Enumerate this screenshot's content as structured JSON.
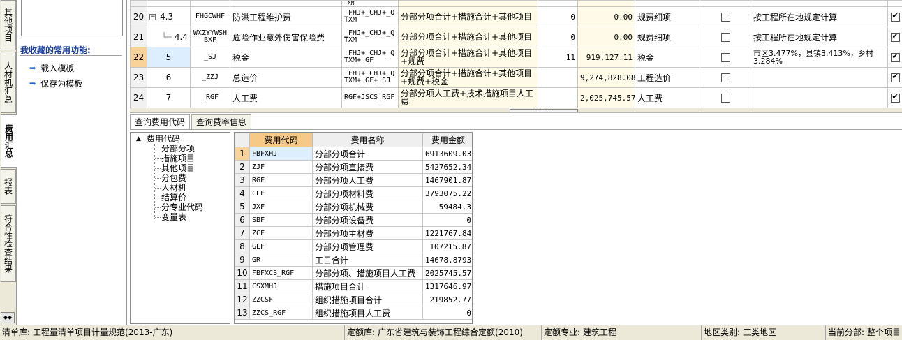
{
  "side_tabs": [
    {
      "label": "其他项目",
      "active": false
    },
    {
      "label": "人材机汇总",
      "active": false
    },
    {
      "label": "费用汇总",
      "active": true
    },
    {
      "label": "报表",
      "active": false
    },
    {
      "label": "符合性检查结果",
      "active": false
    }
  ],
  "favorites": {
    "title": "我收藏的常用功能:",
    "items": [
      "载入模板",
      "保存为模板"
    ]
  },
  "fee_rows": [
    {
      "rownum": "",
      "seq": "",
      "code": "",
      "name": "",
      "base": "TXM",
      "basedesc": "",
      "rate": "",
      "amount": "",
      "type": "",
      "note": "",
      "checked": false,
      "partial": true
    },
    {
      "rownum": "20",
      "seq": "4.3",
      "code": "FHGCWHF",
      "name": "防洪工程维护费",
      "base": "_FHJ+_CHJ+_QTXM",
      "basedesc": "分部分项合计+措施合计+其他项目",
      "rate": "0",
      "amount": "0.00",
      "type": "规费细项",
      "note": "按工程所在地规定计算",
      "checked": true,
      "tree": "minus"
    },
    {
      "rownum": "21",
      "seq": "4.4",
      "code": "WXZYYWSHBXF",
      "name": "危险作业意外伤害保险费",
      "base": "_FHJ+_CHJ+_QTXM",
      "basedesc": "分部分项合计+措施合计+其他项目",
      "rate": "0",
      "amount": "0.00",
      "type": "规费细项",
      "note": "按工程所在地规定计算",
      "checked": true,
      "tree": "leaf"
    },
    {
      "rownum": "22",
      "seq": "5",
      "code": "_SJ",
      "name": "税金",
      "base": "_FHJ+_CHJ+_QTXM+_GF",
      "basedesc": "分部分项合计+措施合计+其他项目+规费",
      "rate": "11",
      "amount": "919,127.11",
      "type": "税金",
      "note": "市区3.477%，县镇3.413%，乡村3.284%",
      "checked": true,
      "selected": true
    },
    {
      "rownum": "23",
      "seq": "6",
      "code": "_ZZJ",
      "name": "总造价",
      "base": "_FHJ+_CHJ+_QTXM+_GF+_SJ",
      "basedesc": "分部分项合计+措施合计+其他项目+规费+税金",
      "rate": "",
      "amount": "9,274,828.08",
      "type": "工程造价",
      "note": "",
      "checked": true
    },
    {
      "rownum": "24",
      "seq": "7",
      "code": "_RGF",
      "name": "人工费",
      "base": "RGF+JSCS_RGF",
      "basedesc": "分部分项人工费+技术措施项目人工费",
      "rate": "",
      "amount": "2,025,745.57",
      "type": "人工费",
      "note": "",
      "checked": true
    }
  ],
  "query_tabs": [
    {
      "label": "查询费用代码",
      "active": true
    },
    {
      "label": "查询费率信息",
      "active": false
    }
  ],
  "tree": {
    "root": "费用代码",
    "children": [
      "分部分项",
      "措施项目",
      "其他项目",
      "分包费",
      "人材机",
      "结算价",
      "分专业代码",
      "变量表"
    ]
  },
  "code_table": {
    "headers": [
      "",
      "费用代码",
      "费用名称",
      "费用金额"
    ],
    "rows": [
      [
        "1",
        "FBFXHJ",
        "分部分项合计",
        "6913609.03"
      ],
      [
        "2",
        "ZJF",
        "分部分项直接费",
        "5427652.34"
      ],
      [
        "3",
        "RGF",
        "分部分项人工费",
        "1467901.87"
      ],
      [
        "4",
        "CLF",
        "分部分项材料费",
        "3793075.22"
      ],
      [
        "5",
        "JXF",
        "分部分项机械费",
        "59484.3"
      ],
      [
        "6",
        "SBF",
        "分部分项设备费",
        "0"
      ],
      [
        "7",
        "ZCF",
        "分部分项主材费",
        "1221767.84"
      ],
      [
        "8",
        "GLF",
        "分部分项管理费",
        "107215.87"
      ],
      [
        "9",
        "GR",
        "工日合计",
        "14678.8793"
      ],
      [
        "10",
        "FBFXCS_RGF",
        "分部分项、措施项目人工费",
        "2025745.57"
      ],
      [
        "11",
        "CSXMHJ",
        "措施项目合计",
        "1317646.97"
      ],
      [
        "12",
        "ZZCSF",
        "组织措施项目合计",
        "219852.77"
      ],
      [
        "13",
        "ZZCS_RGF",
        "组织措施项目人工费",
        "0"
      ]
    ]
  },
  "status": {
    "qd_label": "清单库:",
    "qd_value": "工程量清单项目计量规范(2013-广东)",
    "de_label": "定额库:",
    "de_value": "广东省建筑与装饰工程综合定额(2010)",
    "zy_label": "定额专业:",
    "zy_value": "建筑工程",
    "dq_label": "地区类别:",
    "dq_value": "三类地区",
    "fb_label": "当前分部:",
    "fb_value": "整个项目"
  },
  "colors": {
    "accent_row": "#f9d29a",
    "selected_cell": "#dceeff",
    "calc_cell": "#fffbe8",
    "header_highlight": "#f7c986",
    "title_blue": "#1b3f9b"
  }
}
